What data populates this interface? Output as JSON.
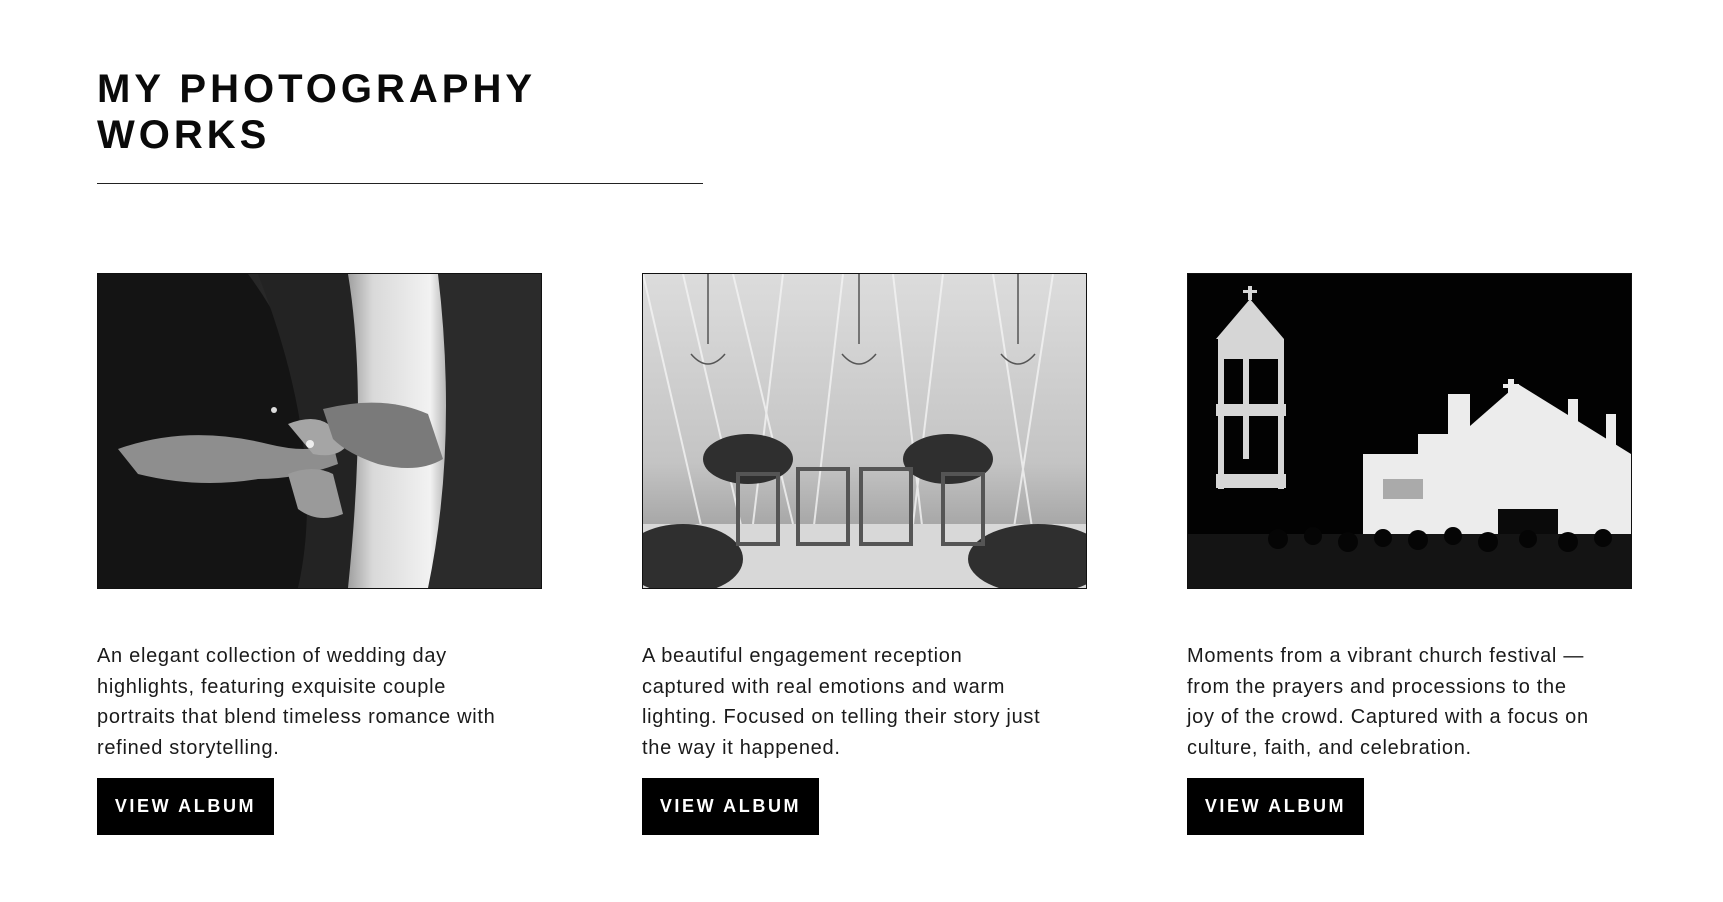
{
  "section": {
    "title_line1": "MY PHOTOGRAPHY",
    "title_line2": "WORKS"
  },
  "albums": [
    {
      "description": "An elegant collection of wedding day highlights, featuring exquisite couple portraits that blend timeless romance with refined storytelling.",
      "button_label": "VIEW ALBUM",
      "photo_subject": "wedding-ring-exchange-photo"
    },
    {
      "description": "A beautiful engagement reception captured with real emotions and warm lighting. Focused on telling their story just the way it happened.",
      "button_label": "VIEW ALBUM",
      "photo_subject": "engagement-stage-photo"
    },
    {
      "description": "Moments from a vibrant church festival — from the prayers and processions to the joy of the crowd. Captured with a focus on culture, faith, and celebration.",
      "button_label": "VIEW ALBUM",
      "photo_subject": "church-festival-photo"
    }
  ],
  "colors": {
    "text": "#111111",
    "button_bg": "#000000",
    "button_text": "#ffffff",
    "background": "#ffffff"
  }
}
